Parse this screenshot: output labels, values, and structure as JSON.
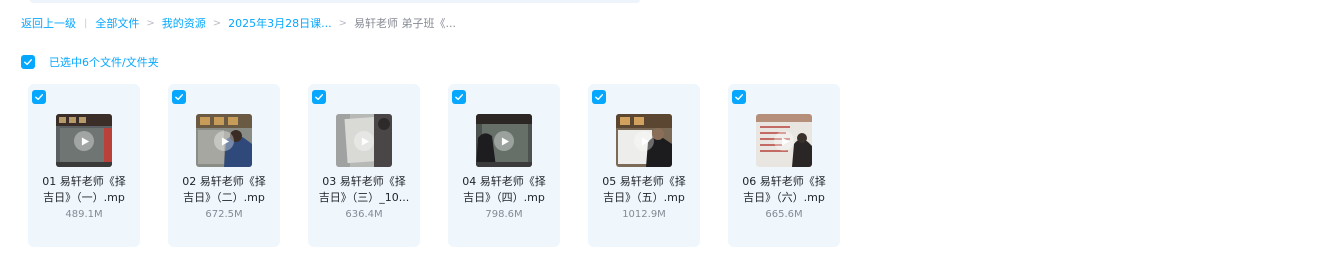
{
  "breadcrumb": {
    "back": "返回上一级",
    "items": [
      "全部文件",
      "我的资源",
      "2025年3月28日课...",
      "易轩老师 弟子班《..."
    ]
  },
  "selection": {
    "text": "已选中6个文件/文件夹"
  },
  "colors": {
    "accent": "#06a7ff",
    "card_bg": "#eff7fd",
    "muted": "#858a93"
  },
  "files": [
    {
      "line1": "01 易轩老师《择",
      "line2": "吉日》（一）.mp",
      "size": "489.1M",
      "icon": "video-thumbnail"
    },
    {
      "line1": "02 易轩老师《择",
      "line2": "吉日》（二）.mp",
      "size": "672.5M",
      "icon": "video-thumbnail"
    },
    {
      "line1": "03 易轩老师《择",
      "line2": "吉日》（三）_10...",
      "size": "636.4M",
      "icon": "video-thumbnail"
    },
    {
      "line1": "04 易轩老师《择",
      "line2": "吉日》（四）.mp",
      "size": "798.6M",
      "icon": "video-thumbnail"
    },
    {
      "line1": "05 易轩老师《择",
      "line2": "吉日》（五）.mp",
      "size": "1012.9M",
      "icon": "video-thumbnail"
    },
    {
      "line1": "06 易轩老师《择",
      "line2": "吉日》（六）.mp",
      "size": "665.6M",
      "icon": "video-thumbnail"
    }
  ]
}
